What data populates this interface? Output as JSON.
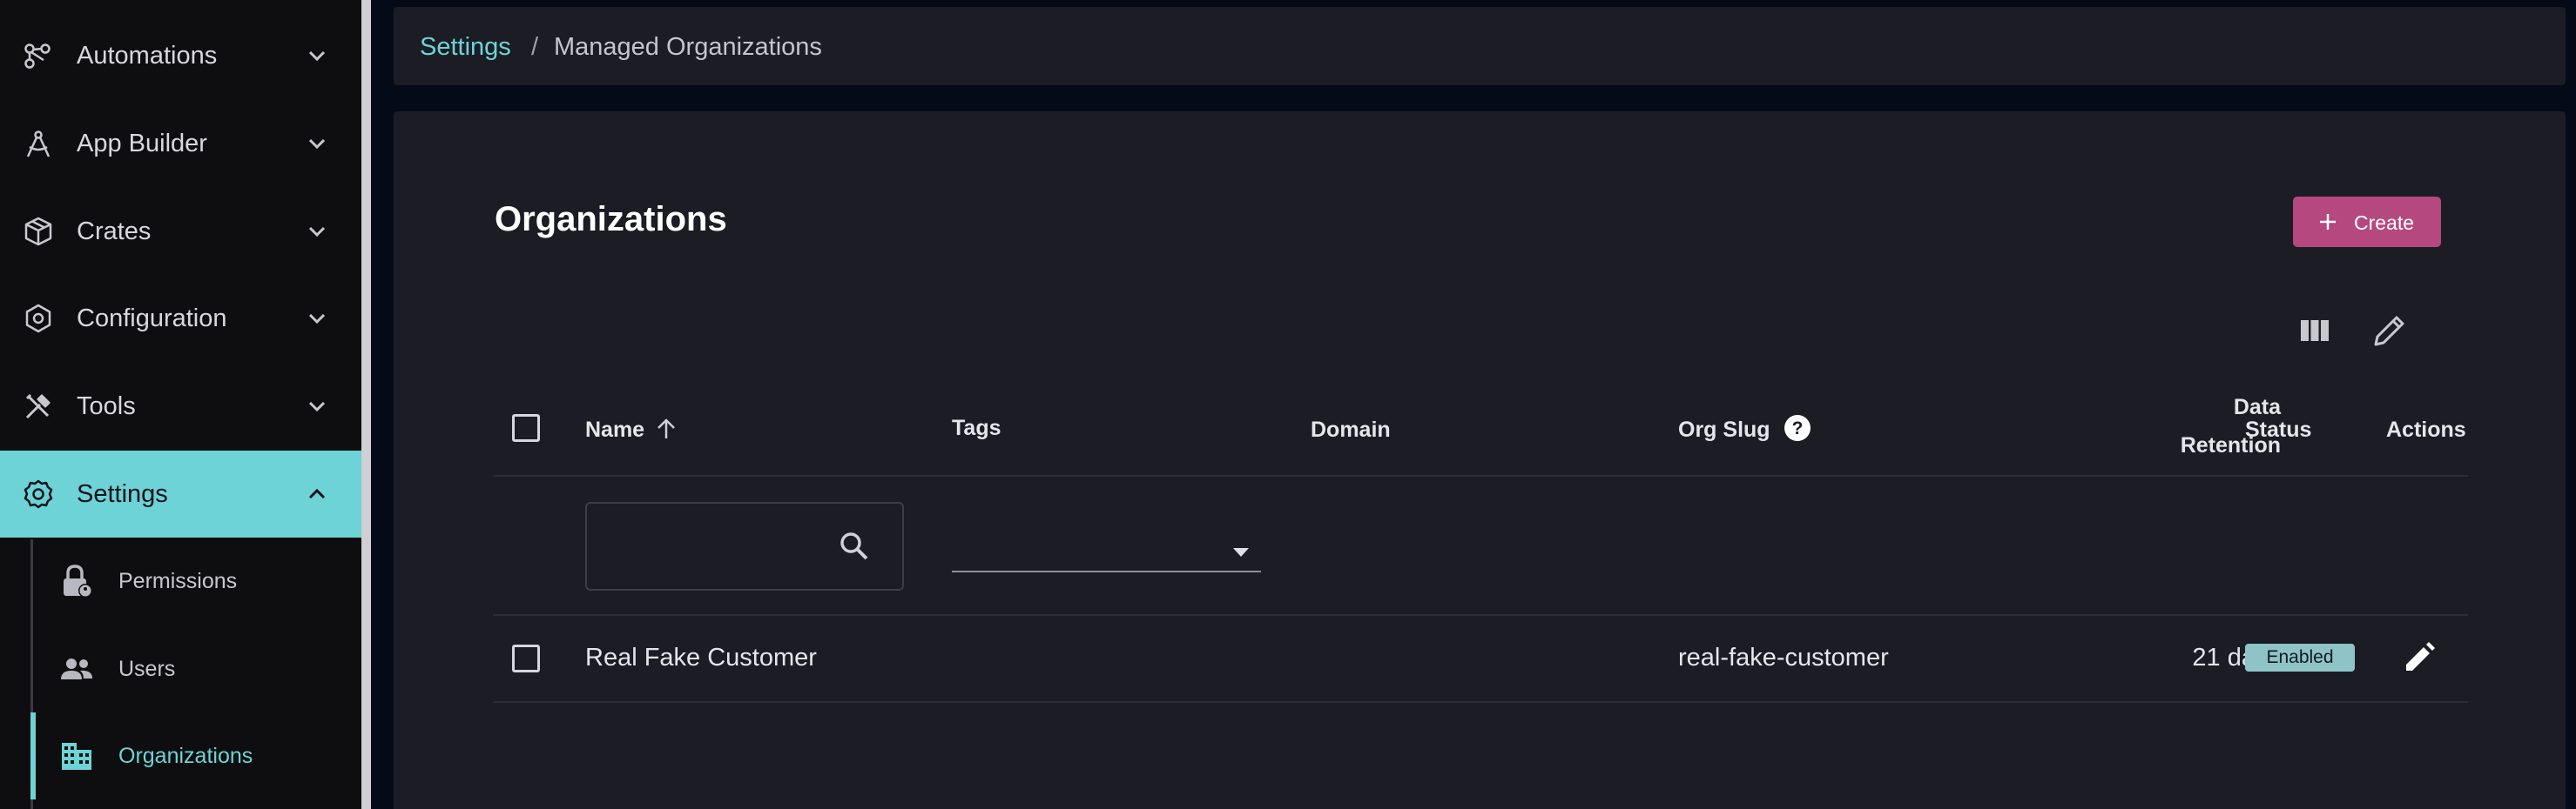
{
  "sidebar": {
    "items": [
      {
        "label": "Automations",
        "icon": "automations-icon"
      },
      {
        "label": "App Builder",
        "icon": "app-builder-icon"
      },
      {
        "label": "Crates",
        "icon": "crates-icon"
      },
      {
        "label": "Configuration",
        "icon": "configuration-icon"
      },
      {
        "label": "Tools",
        "icon": "tools-icon"
      },
      {
        "label": "Settings",
        "icon": "settings-icon"
      }
    ],
    "subitems": [
      {
        "label": "Permissions",
        "icon": "lock-icon"
      },
      {
        "label": "Users",
        "icon": "users-icon"
      },
      {
        "label": "Organizations",
        "icon": "organizations-icon"
      }
    ],
    "active_item": "Settings",
    "active_subitem": "Organizations"
  },
  "breadcrumb": {
    "parent": "Settings",
    "separator": "/",
    "current": "Managed Organizations"
  },
  "page": {
    "title": "Organizations",
    "create_label": "Create"
  },
  "table": {
    "columns": {
      "name": "Name",
      "tags": "Tags",
      "domain": "Domain",
      "org_slug": "Org Slug",
      "data_retention_line1": "Data",
      "data_retention_line2": "Retention",
      "status": "Status",
      "actions": "Actions"
    },
    "sort": {
      "column": "Name",
      "direction": "ascending"
    },
    "filters": {
      "name_value": "",
      "tags_value": ""
    },
    "rows": [
      {
        "name": "Real Fake Customer",
        "tags": "",
        "domain": "",
        "org_slug": "real-fake-customer",
        "data_retention": "21 days",
        "status": "Enabled"
      }
    ]
  },
  "colors": {
    "accent": "#6dd3d6",
    "create_button": "#b5497f",
    "status_enabled": "#8ec4c7",
    "panel": "#1b1c24",
    "sidebar": "#0e0e10"
  }
}
